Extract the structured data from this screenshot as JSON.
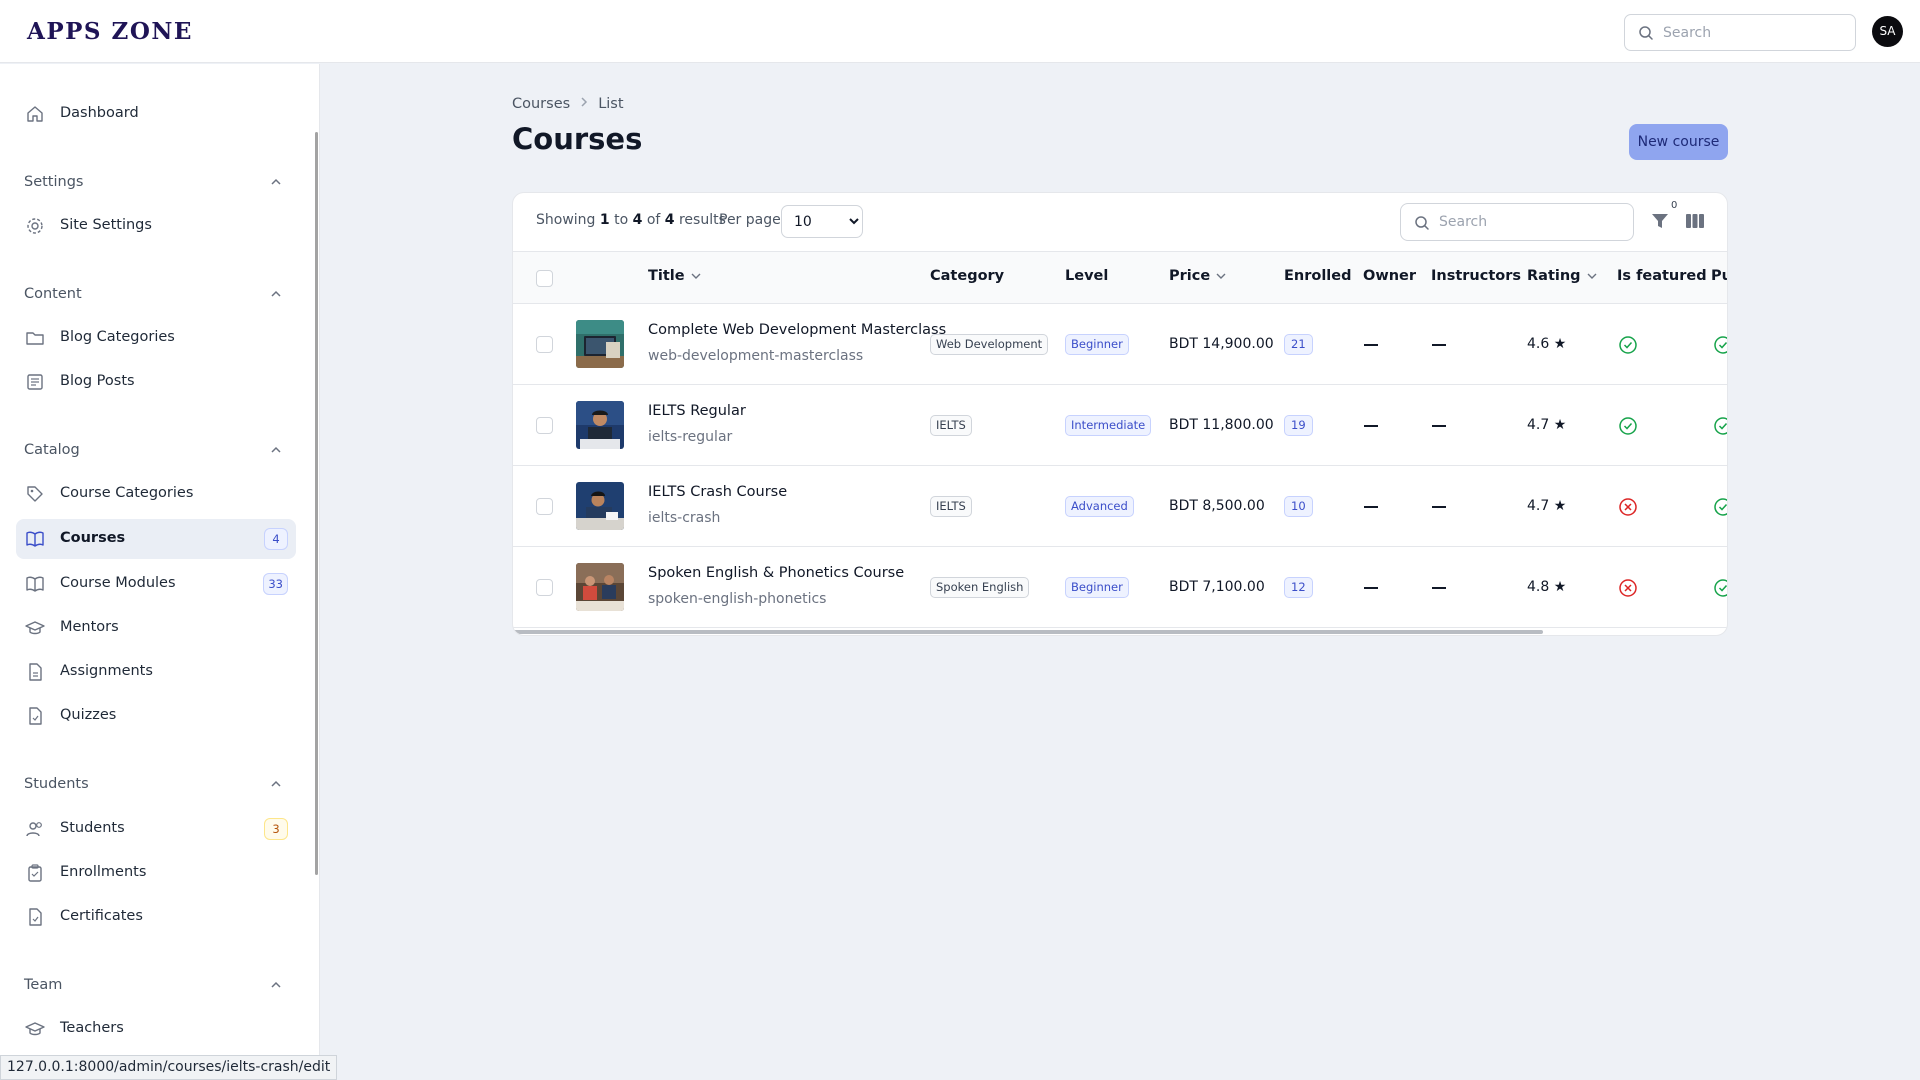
{
  "app": {
    "logo": "APPS ZONE",
    "search_placeholder": "Search",
    "avatar_initials": "SA"
  },
  "status_url": "127.0.0.1:8000/admin/courses/ielts-crash/edit",
  "sidebar": {
    "dashboard": "Dashboard",
    "groups": {
      "settings": "Settings",
      "content": "Content",
      "catalog": "Catalog",
      "students": "Students",
      "team": "Team"
    },
    "items": {
      "site_settings": "Site Settings",
      "blog_categories": "Blog Categories",
      "blog_posts": "Blog Posts",
      "course_categories": "Course Categories",
      "courses": "Courses",
      "courses_badge": "4",
      "course_modules": "Course Modules",
      "course_modules_badge": "33",
      "mentors": "Mentors",
      "assignments": "Assignments",
      "quizzes": "Quizzes",
      "students": "Students",
      "students_badge": "3",
      "enrollments": "Enrollments",
      "certificates": "Certificates",
      "teachers": "Teachers"
    }
  },
  "breadcrumb": {
    "first": "Courses",
    "second": "List"
  },
  "page": {
    "title": "Courses",
    "new_button": "New course"
  },
  "table": {
    "showing_prefix": "Showing",
    "showing_from": "1",
    "showing_to_word": "to",
    "showing_to": "4",
    "showing_of_word": "of",
    "showing_total": "4",
    "showing_suffix": "results",
    "per_page_label": "Per page",
    "per_page_value": "10",
    "search_placeholder": "Search",
    "filter_count": "0",
    "columns": {
      "title": "Title",
      "category": "Category",
      "level": "Level",
      "price": "Price",
      "enrolled": "Enrolled",
      "owner": "Owner",
      "instructors": "Instructors",
      "rating": "Rating",
      "is_featured": "Is featured",
      "published": "Pu"
    },
    "rows": [
      {
        "title": "Complete Web Development Masterclass",
        "slug": "web-development-masterclass",
        "category": "Web Development",
        "level": "Beginner",
        "price": "BDT 14,900.00",
        "enrolled": "21",
        "rating": "4.6 ★",
        "featured": true,
        "published": true
      },
      {
        "title": "IELTS Regular",
        "slug": "ielts-regular",
        "category": "IELTS",
        "level": "Intermediate",
        "price": "BDT 11,800.00",
        "enrolled": "19",
        "rating": "4.7 ★",
        "featured": true,
        "published": true
      },
      {
        "title": "IELTS Crash Course",
        "slug": "ielts-crash",
        "category": "IELTS",
        "level": "Advanced",
        "price": "BDT 8,500.00",
        "enrolled": "10",
        "rating": "4.7 ★",
        "featured": false,
        "published": true
      },
      {
        "title": "Spoken English & Phonetics Course",
        "slug": "spoken-english-phonetics",
        "category": "Spoken English",
        "level": "Beginner",
        "price": "BDT 7,100.00",
        "enrolled": "12",
        "rating": "4.8 ★",
        "featured": false,
        "published": true
      }
    ]
  },
  "colors": {
    "accent": "#8fa5ef",
    "success": "#16a34a",
    "danger": "#dc2626",
    "logo": "#1f1456"
  }
}
